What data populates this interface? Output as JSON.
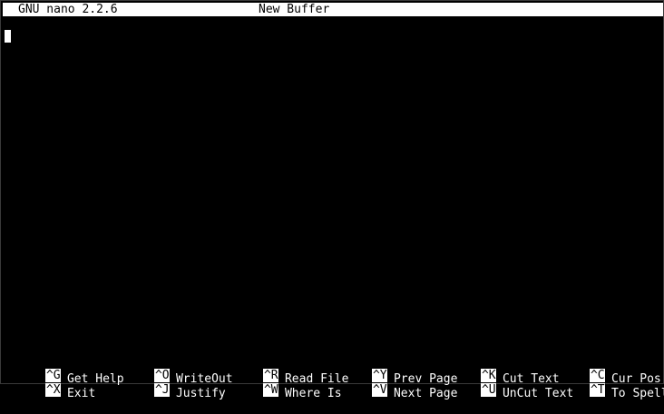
{
  "title_bar": {
    "app_version": "GNU nano 2.2.6",
    "buffer_name": "New Buffer"
  },
  "shortcuts": {
    "row1": [
      {
        "key": "^G",
        "label": "Get Help"
      },
      {
        "key": "^O",
        "label": "WriteOut"
      },
      {
        "key": "^R",
        "label": "Read File"
      },
      {
        "key": "^Y",
        "label": "Prev Page"
      },
      {
        "key": "^K",
        "label": "Cut Text"
      },
      {
        "key": "^C",
        "label": "Cur Pos"
      }
    ],
    "row2": [
      {
        "key": "^X",
        "label": "Exit"
      },
      {
        "key": "^J",
        "label": "Justify"
      },
      {
        "key": "^W",
        "label": "Where Is"
      },
      {
        "key": "^V",
        "label": "Next Page"
      },
      {
        "key": "^U",
        "label": "UnCut Text"
      },
      {
        "key": "^T",
        "label": "To Spell"
      }
    ]
  },
  "colors": {
    "background": "#000000",
    "foreground": "#ffffff",
    "inverse_text": "#000000"
  }
}
